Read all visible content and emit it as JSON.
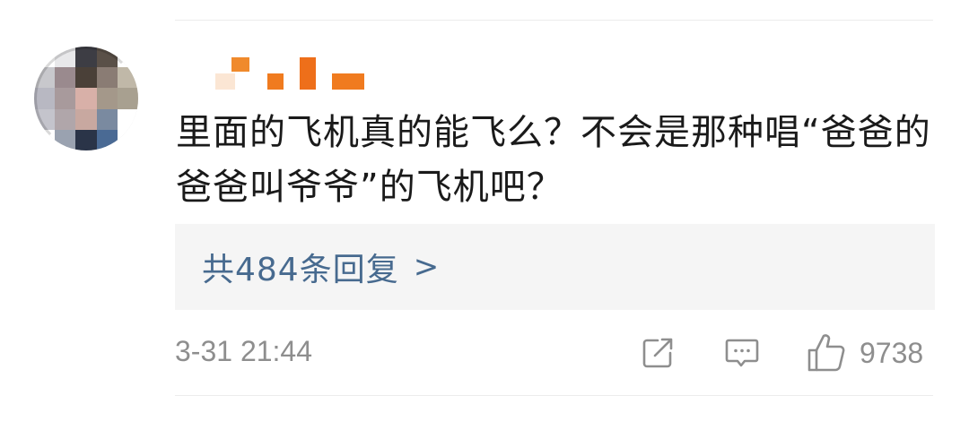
{
  "comment": {
    "text": "里面的飞机真的能飞么？不会是那种唱“爸爸的爸爸叫爷爷”的飞机吧？",
    "replies_label": "共484条回复",
    "replies_chevron": ">",
    "timestamp": "3-31 21:44",
    "like_count": "9738"
  },
  "icons": {
    "share": "share-icon",
    "comment": "comment-icon",
    "like": "thumbs-up-icon"
  },
  "colors": {
    "link": "#476a8f",
    "muted": "#8e8e8e",
    "username_orange": "#f07b1f"
  }
}
